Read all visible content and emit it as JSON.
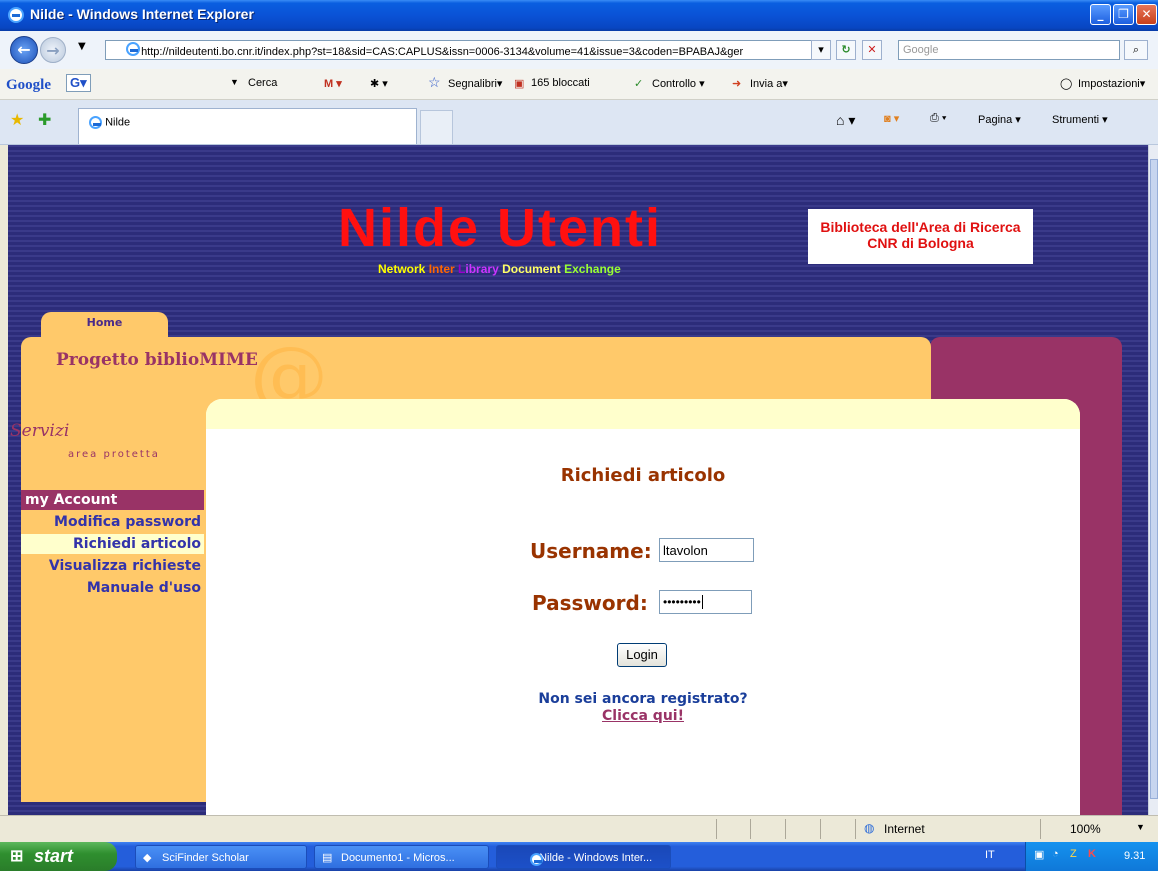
{
  "window": {
    "title": "Nilde - Windows Internet Explorer"
  },
  "addressbar": {
    "url": "http://nildeutenti.bo.cnr.it/index.php?st=18&sid=CAS:CAPLUS&issn=0006-3134&volume=41&issue=3&coden=BPABAJ&ger",
    "search_placeholder": "Google"
  },
  "google_toolbar": {
    "logo": "Google",
    "g_label": "G▾",
    "search_label": "Cerca",
    "bookmarks_label": "Segnalibri▾",
    "blocked_label": "165 bloccati",
    "check_label": "Controllo ▾",
    "send_label": "Invia a▾",
    "settings_label": "Impostazioni▾"
  },
  "tabs": [
    {
      "label": "Nilde"
    }
  ],
  "command_bar": {
    "page_label": "Pagina ▾",
    "tools_label": "Strumenti ▾"
  },
  "page": {
    "logo_title": "Nilde Utenti",
    "logo_sub": [
      {
        "text": "N",
        "color": "#ffff00"
      },
      {
        "text": "etwork ",
        "color": "#ffff00"
      },
      {
        "text": "I",
        "color": "#ff6600"
      },
      {
        "text": "nter ",
        "color": "#ff6600"
      },
      {
        "text": "L",
        "color": "#9900cc"
      },
      {
        "text": "ibrary ",
        "color": "#cc33ff"
      },
      {
        "text": "D",
        "color": "#ffff66"
      },
      {
        "text": "ocument ",
        "color": "#ffff66"
      },
      {
        "text": "E",
        "color": "#99ff33"
      },
      {
        "text": "xchange",
        "color": "#99ff33"
      }
    ],
    "library_line1": "Biblioteca dell'Area di Ricerca",
    "library_line2": "CNR di Bologna",
    "home_tab": "Home",
    "project_title": "Progetto biblioMIME",
    "services_title": "Servizi",
    "services_sub": "area protetta",
    "menu": {
      "header": "my Account",
      "items": [
        "Modifica password",
        "Richiedi articolo",
        "Visualizza richieste",
        "Manuale d'uso"
      ]
    },
    "heading": "Richiedi articolo",
    "username_label": "Username:",
    "username_value": "ltavolon",
    "password_label": "Password:",
    "password_value": "•••••••••",
    "login_label": "Login",
    "not_registered": "Non sei ancora registrato?",
    "click_here": "Clicca qui!"
  },
  "statusbar": {
    "zone": "Internet",
    "zoom": "100%"
  },
  "taskbar": {
    "start": "start",
    "tasks": [
      "SciFinder Scholar",
      "Documento1 - Micros...",
      "Nilde - Windows Inter..."
    ],
    "lang": "IT",
    "clock": "9.31"
  },
  "colors": {
    "accent": "#993366",
    "panel": "#ffc96a",
    "background": "#2c2c7a",
    "title_red": "#ff1010"
  }
}
